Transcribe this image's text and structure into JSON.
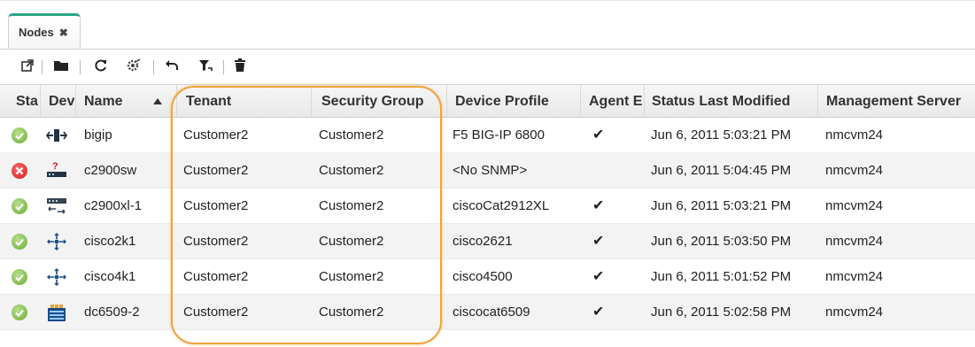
{
  "tabs": [
    {
      "label": "Nodes",
      "close_icon": "✖"
    }
  ],
  "toolbar": {
    "buttons": [
      {
        "icon": "open-external-icon"
      },
      {
        "icon": "folder-icon"
      },
      {
        "icon": "refresh-icon"
      },
      {
        "icon": "configure-poll-icon"
      },
      {
        "icon": "undo-icon"
      },
      {
        "icon": "filter-undo-icon"
      },
      {
        "icon": "delete-icon"
      }
    ]
  },
  "table": {
    "columns": [
      "Sta",
      "Dev",
      "Name",
      "Tenant",
      "Security Group",
      "Device Profile",
      "Agent E",
      "Status Last Modified",
      "Management Server"
    ],
    "sort_column": "Name",
    "sort_direction": "ascending",
    "rows": [
      {
        "status": "ok",
        "device_icon": "load-balancer-icon",
        "name": "bigip",
        "tenant": "Customer2",
        "security_group": "Customer2",
        "device_profile": "F5 BIG-IP 6800",
        "agent": "✔",
        "modified": "Jun 6, 2011 5:03:21 PM",
        "server": "nmcvm24"
      },
      {
        "status": "error",
        "device_icon": "unknown-device-icon",
        "name": "c2900sw",
        "tenant": "Customer2",
        "security_group": "Customer2",
        "device_profile": "<No SNMP>",
        "agent": "",
        "modified": "Jun 6, 2011 5:04:45 PM",
        "server": "nmcvm24"
      },
      {
        "status": "ok",
        "device_icon": "switch-icon",
        "name": "c2900xl-1",
        "tenant": "Customer2",
        "security_group": "Customer2",
        "device_profile": "ciscoCat2912XL",
        "agent": "✔",
        "modified": "Jun 6, 2011 5:03:21 PM",
        "server": "nmcvm24"
      },
      {
        "status": "ok",
        "device_icon": "router-icon",
        "name": "cisco2k1",
        "tenant": "Customer2",
        "security_group": "Customer2",
        "device_profile": "cisco2621",
        "agent": "✔",
        "modified": "Jun 6, 2011 5:03:50 PM",
        "server": "nmcvm24"
      },
      {
        "status": "ok",
        "device_icon": "router-icon",
        "name": "cisco4k1",
        "tenant": "Customer2",
        "security_group": "Customer2",
        "device_profile": "cisco4500",
        "agent": "✔",
        "modified": "Jun 6, 2011 5:01:52 PM",
        "server": "nmcvm24"
      },
      {
        "status": "ok",
        "device_icon": "chassis-switch-icon",
        "name": "dc6509-2",
        "tenant": "Customer2",
        "security_group": "Customer2",
        "device_profile": "ciscocat6509",
        "agent": "✔",
        "modified": "Jun 6, 2011 5:02:58 PM",
        "server": "nmcvm24"
      }
    ]
  },
  "colors": {
    "accent": "#2aa38a",
    "highlight": "#f0a33a",
    "ok": "#6aae36",
    "error": "#d01f1f"
  }
}
